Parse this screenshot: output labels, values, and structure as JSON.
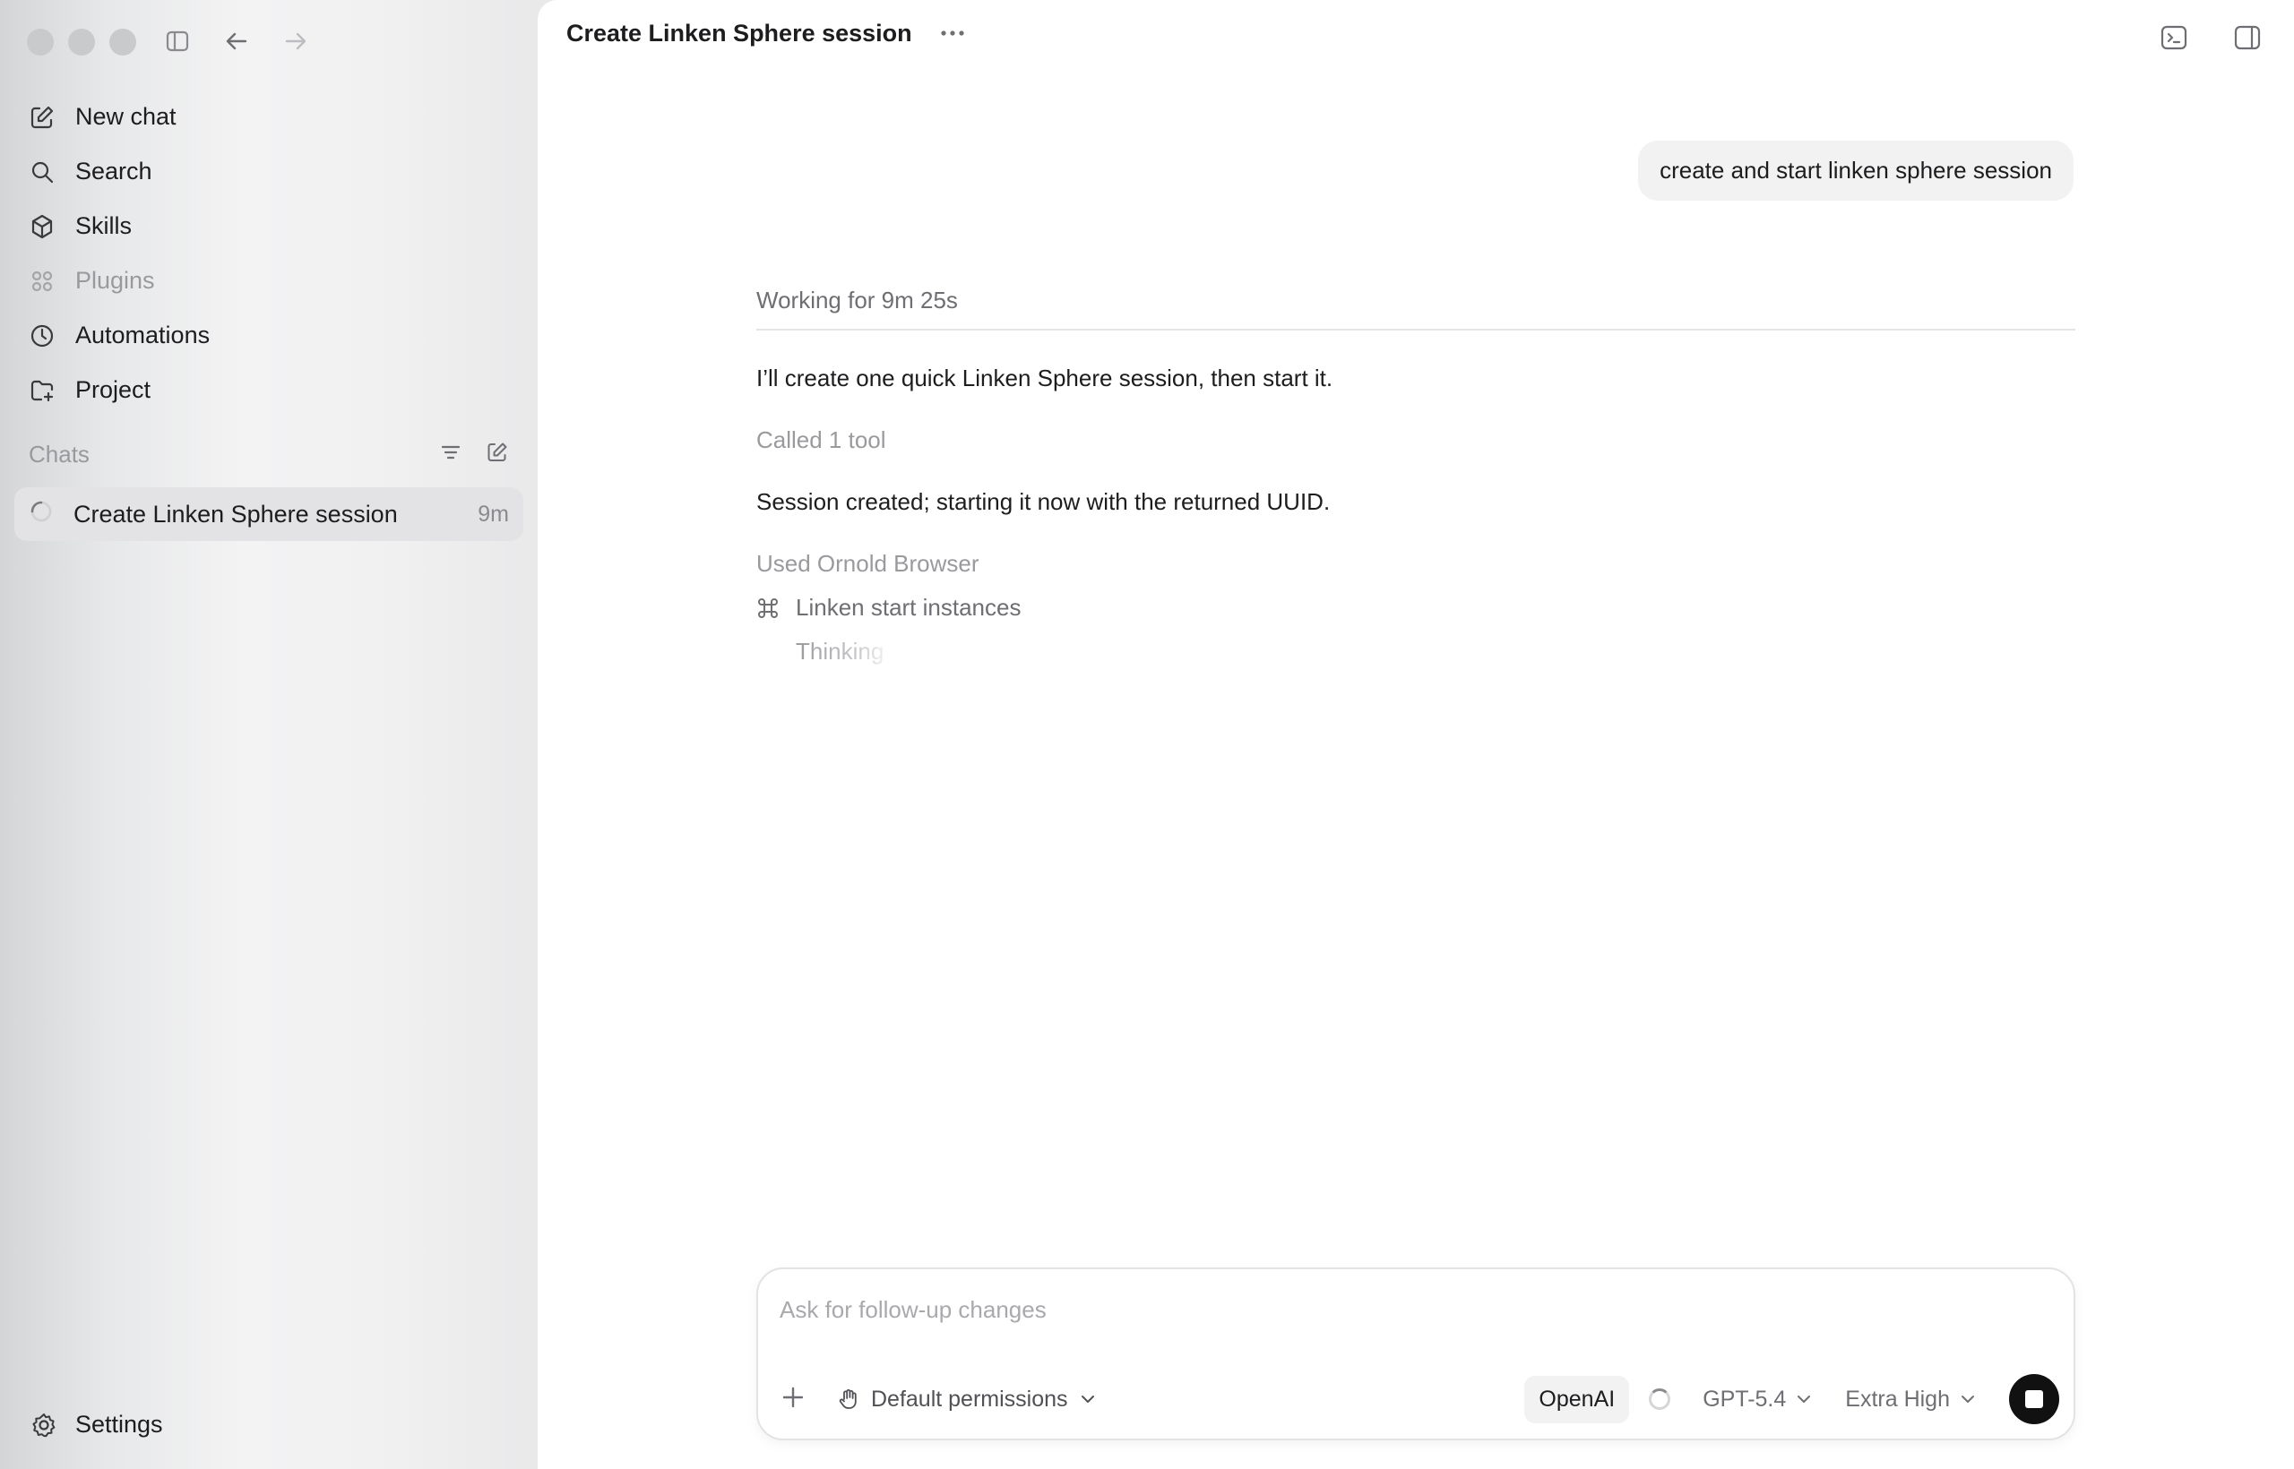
{
  "sidebar": {
    "nav": [
      {
        "label": "New chat",
        "icon": "edit-icon"
      },
      {
        "label": "Search",
        "icon": "search-icon"
      },
      {
        "label": "Skills",
        "icon": "cube-icon"
      },
      {
        "label": "Plugins",
        "icon": "grid-icon"
      },
      {
        "label": "Automations",
        "icon": "clock-icon"
      },
      {
        "label": "Project",
        "icon": "folder-plus-icon"
      }
    ],
    "chats_label": "Chats",
    "chats": [
      {
        "title": "Create Linken Sphere session",
        "time": "9m"
      }
    ],
    "settings_label": "Settings"
  },
  "header": {
    "title": "Create Linken Sphere session",
    "more": "···"
  },
  "thread": {
    "user_message": "create and start linken sphere session",
    "working": "Working for 9m 25s",
    "msg1": "I’ll create one quick Linken Sphere session, then start it.",
    "meta1": "Called 1 tool",
    "msg2": "Session created; starting it now with the returned UUID.",
    "meta2": "Used Ornold Browser",
    "tool_label": "Linken start instances",
    "thinking": "Thinking"
  },
  "composer": {
    "placeholder": "Ask for follow-up changes",
    "permissions": "Default permissions",
    "provider": "OpenAI",
    "model": "GPT-5.4",
    "effort": "Extra High"
  },
  "colors": {
    "accent": "#111111",
    "bubble": "#f2f2f3",
    "sidebar": "#f1f1f2"
  }
}
